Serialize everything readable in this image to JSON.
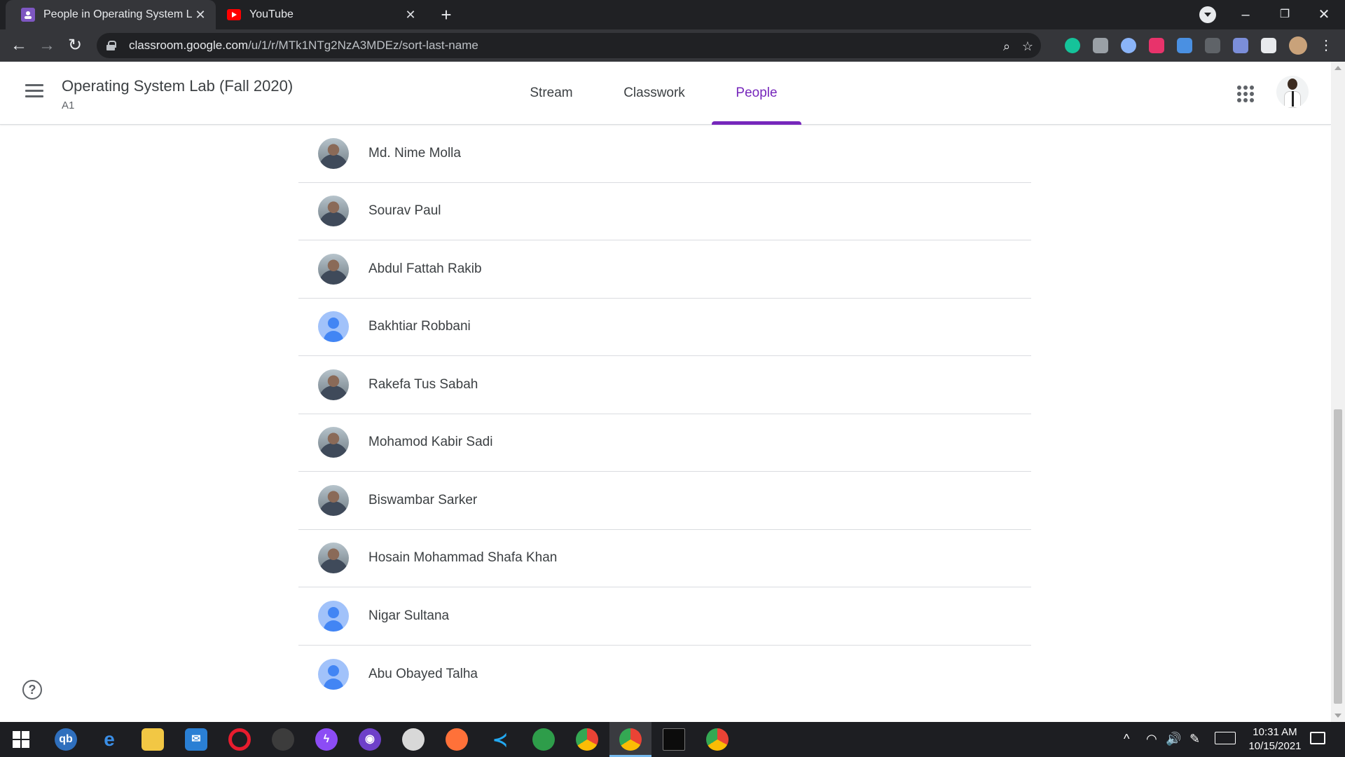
{
  "browser": {
    "tabs": [
      {
        "title": "People in Operating System Lab (",
        "favicon": "classroom-icon",
        "active": true
      },
      {
        "title": "YouTube",
        "favicon": "youtube-icon",
        "active": false
      }
    ],
    "new_tab_label": "+",
    "url_host": "classroom.google.com",
    "url_path": "/u/1/r/MTk1NTg2NzA3MDEz/sort-last-name",
    "extensions": [
      "grammarly-icon",
      "camera-icon",
      "ext-icon",
      "ext-play-icon",
      "download-icon",
      "ext-icon",
      "pen-icon",
      "puzzle-icon"
    ]
  },
  "header": {
    "course_title": "Operating System Lab (Fall 2020)",
    "section": "A1",
    "tabs": [
      {
        "label": "Stream"
      },
      {
        "label": "Classwork"
      },
      {
        "label": "People",
        "active": true
      }
    ]
  },
  "people": [
    {
      "name": "Md. Nime Molla",
      "avatar": "photo"
    },
    {
      "name": "Sourav Paul",
      "avatar": "photo"
    },
    {
      "name": "Abdul Fattah Rakib",
      "avatar": "photo"
    },
    {
      "name": "Bakhtiar Robbani",
      "avatar": "default"
    },
    {
      "name": "Rakefa Tus Sabah",
      "avatar": "photo"
    },
    {
      "name": "Mohamod Kabir Sadi",
      "avatar": "photo"
    },
    {
      "name": "Biswambar Sarker",
      "avatar": "photo"
    },
    {
      "name": "Hosain Mohammad Shafa Khan",
      "avatar": "photo"
    },
    {
      "name": "Nigar Sultana",
      "avatar": "default"
    },
    {
      "name": "Abu Obayed Talha",
      "avatar": "default"
    }
  ],
  "help_label": "?",
  "colors": {
    "accent": "#7627bb",
    "default_avatar": "#4285f4"
  },
  "taskbar": {
    "time": "10:31 AM",
    "date": "10/15/2021",
    "apps": [
      "windows-start-icon",
      "qbittorrent-icon",
      "edge-icon",
      "file-explorer-icon",
      "mail-icon",
      "opera-icon",
      "inkscape-icon",
      "messenger-icon",
      "github-icon",
      "paint-icon",
      "firefox-icon",
      "vscode-icon",
      "app-icon",
      "chrome-icon",
      "chrome-icon",
      "terminal-icon",
      "chrome-icon"
    ]
  }
}
